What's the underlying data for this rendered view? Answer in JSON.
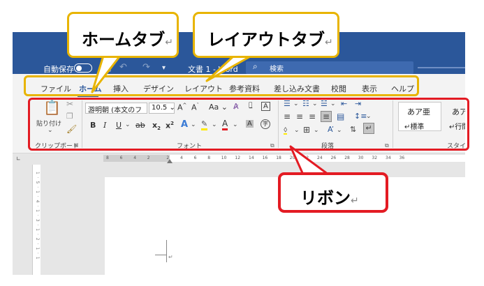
{
  "titlebar": {
    "autosave_label": "自動保存",
    "doc_title": "文書 1 - Word",
    "search_placeholder": "検索"
  },
  "tabs": [
    "ファイル",
    "ホーム",
    "挿入",
    "デザイン",
    "レイアウト",
    "参考資料",
    "差し込み文書",
    "校閲",
    "表示",
    "ヘルプ"
  ],
  "active_tab": "ホーム",
  "ribbon": {
    "clipboard": {
      "paste_label": "貼り付け",
      "group_label": "クリップボード"
    },
    "font": {
      "font_name": "游明朝 (本文のフ",
      "font_size": "10.5",
      "grow_font": "A",
      "shrink_font": "A",
      "change_case": "Aa",
      "bold": "B",
      "italic": "I",
      "underline": "U",
      "strikethrough": "ab",
      "subscript": "x",
      "superscript": "x",
      "text_effect": "A",
      "font_color": "A",
      "char_shading": "A",
      "enclosed_char": "字",
      "group_label": "フォント"
    },
    "paragraph": {
      "group_label": "段落"
    },
    "styles": {
      "sample_text": "あア亜",
      "standard_label": "標準",
      "no_spacing_sample": "あア",
      "no_spacing_label": "行間",
      "group_label": "スタイ"
    }
  },
  "ruler": {
    "numbers": [
      "8",
      "6",
      "4",
      "2",
      "2",
      "4",
      "6",
      "8",
      "10",
      "12",
      "14",
      "16",
      "18",
      "20",
      "22",
      "24",
      "26",
      "28",
      "30",
      "32",
      "34",
      "36"
    ],
    "vertical_marks": "1 · 5 · 1 · 4 · 1 · 3 · 1 · 2 · 1 · 1"
  },
  "callouts": {
    "home_tab": "ホームタブ",
    "layout_tab": "レイアウトタブ",
    "ribbon": "リボン"
  },
  "colors": {
    "titlebar": "#2b579a",
    "callout_yellow": "#e8b400",
    "callout_red": "#e31b23"
  },
  "icons": [
    "paste-icon",
    "cut-icon",
    "copy-icon",
    "format-painter-icon",
    "save-icon",
    "undo-icon",
    "redo-icon",
    "search-icon",
    "clear-format-icon",
    "bullets-icon",
    "numbering-icon",
    "multilevel-list-icon",
    "decrease-indent-icon",
    "increase-indent-icon",
    "align-left-icon",
    "center-icon",
    "align-right-icon",
    "justify-icon",
    "distributed-icon",
    "line-spacing-icon",
    "shading-icon",
    "borders-icon",
    "sort-icon",
    "show-marks-icon",
    "return-mark-icon"
  ]
}
